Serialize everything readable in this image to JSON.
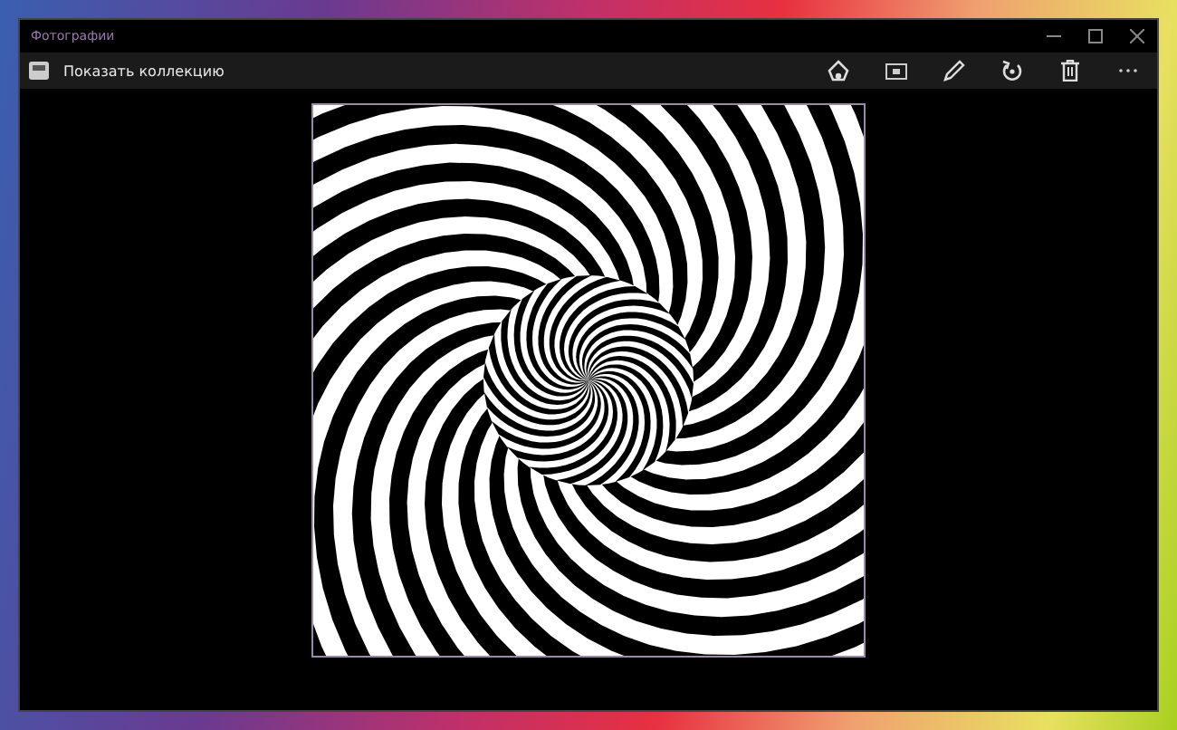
{
  "window": {
    "title": "Фотографии"
  },
  "toolbar": {
    "collection_button": "Показать коллекцию"
  }
}
